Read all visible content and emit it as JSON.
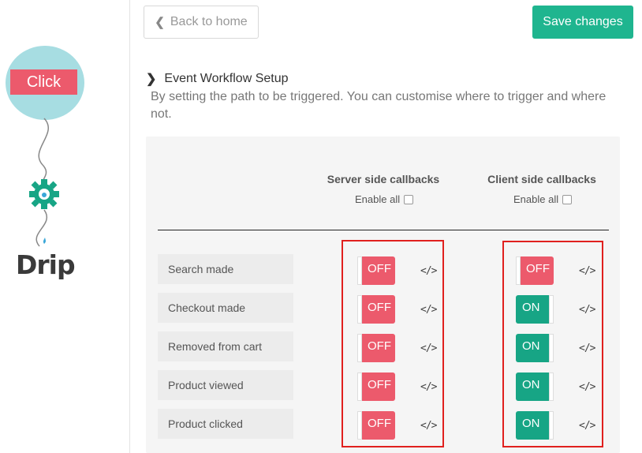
{
  "sidebar": {
    "click_label": "Click",
    "drip_label": "Drip"
  },
  "header": {
    "back_label": "Back to home",
    "save_label": "Save changes"
  },
  "section": {
    "title": "Event Workflow Setup",
    "description": "By setting the path to be triggered. You can customise where to trigger and where not."
  },
  "columns": {
    "server": {
      "title": "Server side callbacks",
      "enable_all": "Enable all"
    },
    "client": {
      "title": "Client side callbacks",
      "enable_all": "Enable all"
    }
  },
  "events": [
    {
      "label": "Search made",
      "server": "OFF",
      "client": "OFF"
    },
    {
      "label": "Checkout made",
      "server": "OFF",
      "client": "ON"
    },
    {
      "label": "Removed from cart",
      "server": "OFF",
      "client": "ON"
    },
    {
      "label": "Product viewed",
      "server": "OFF",
      "client": "ON"
    },
    {
      "label": "Product clicked",
      "server": "OFF",
      "client": "ON"
    }
  ],
  "code_icon_glyph": "</>",
  "colors": {
    "off": "#ec5a6c",
    "on": "#17a585",
    "save": "#1fb58f",
    "highlight": "#e0201e",
    "click_circle": "#a7dde2"
  },
  "icons": {
    "back": "chevron-left-icon",
    "section": "chevron-right-icon",
    "code": "code-icon",
    "gear": "gear-icon"
  }
}
